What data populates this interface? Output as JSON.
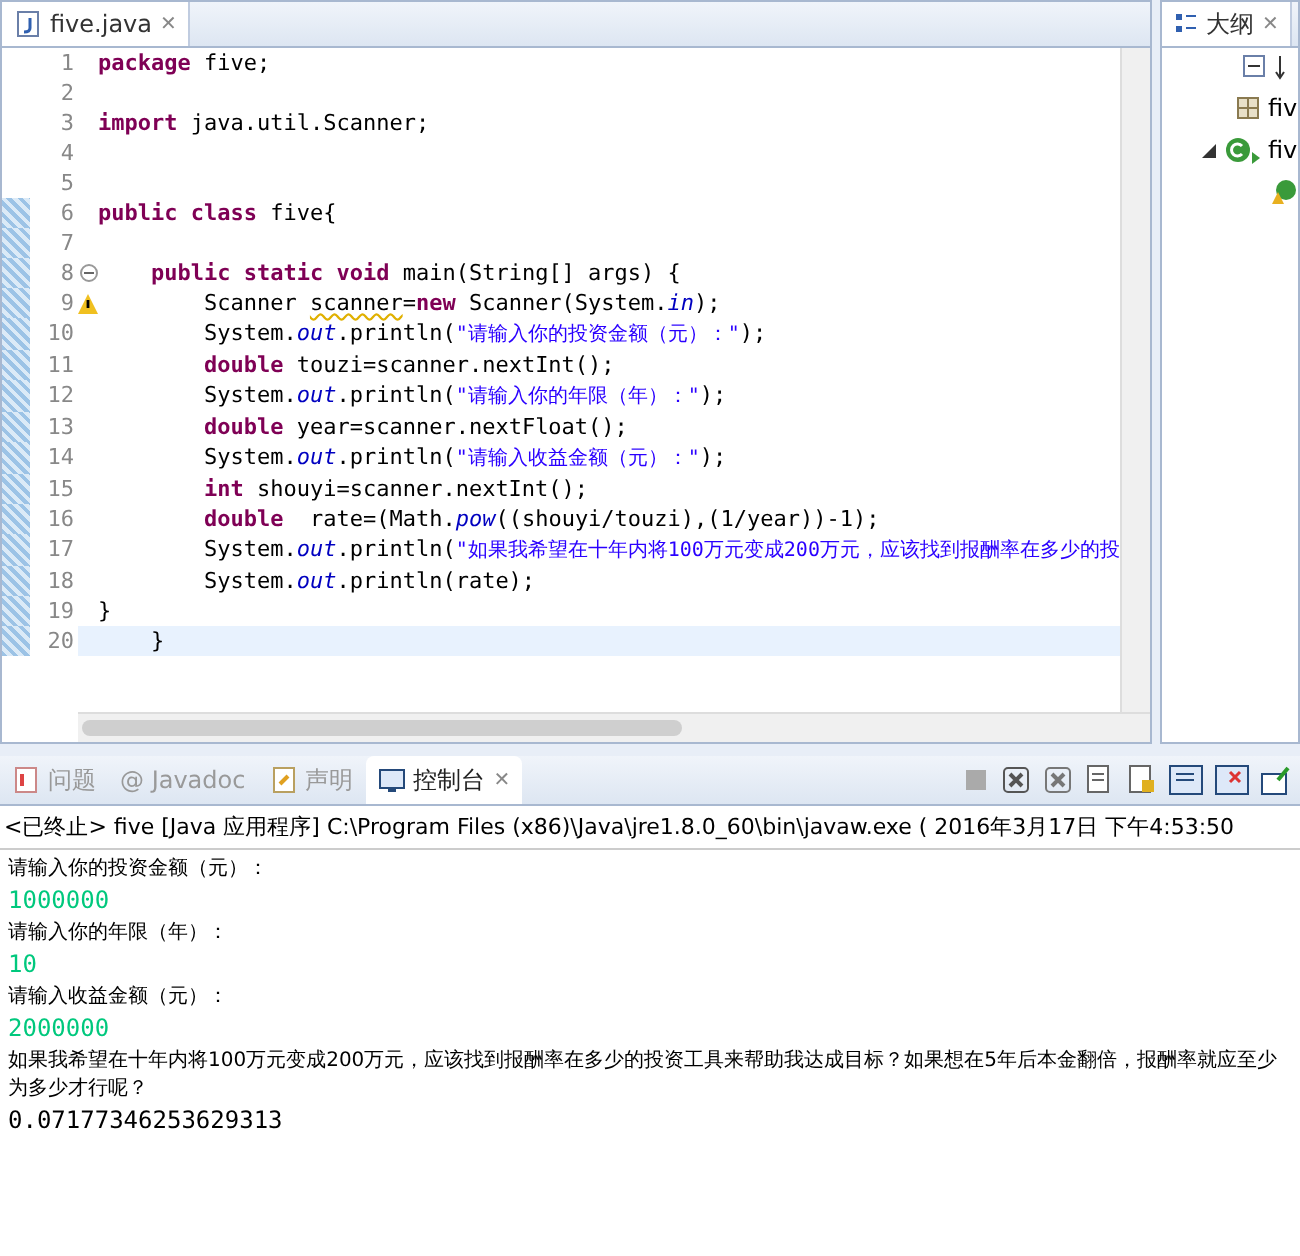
{
  "editor": {
    "tabs": [
      {
        "label": "five.java",
        "close": "✕",
        "selected": true
      }
    ],
    "lines": [
      {
        "num": "1",
        "changed": false,
        "current": false,
        "foldable": false,
        "warning": false,
        "tokens": [
          {
            "kind": "kw",
            "text": "package"
          },
          {
            "kind": "id",
            "text": " five;"
          }
        ]
      },
      {
        "num": "2",
        "changed": false,
        "current": false,
        "foldable": false,
        "warning": false
      },
      {
        "num": "3",
        "changed": false,
        "current": false,
        "foldable": false,
        "warning": false,
        "tokens": [
          {
            "kind": "kw",
            "text": "import"
          },
          {
            "kind": "id",
            "text": " java.util.Scanner;"
          }
        ]
      },
      {
        "num": "4",
        "changed": false,
        "current": false,
        "foldable": false,
        "warning": false
      },
      {
        "num": "5",
        "changed": false,
        "current": false,
        "foldable": false,
        "warning": false
      },
      {
        "num": "6",
        "changed": true,
        "current": false,
        "foldable": false,
        "warning": false,
        "tokens": [
          {
            "kind": "kw",
            "text": "public class"
          },
          {
            "kind": "id",
            "text": " five{"
          }
        ]
      },
      {
        "num": "7",
        "changed": true,
        "current": false,
        "foldable": false,
        "warning": false
      },
      {
        "num": "8",
        "changed": true,
        "current": false,
        "foldable": true,
        "warning": false,
        "tokens": [
          {
            "kind": "kw",
            "text": "    public static void"
          },
          {
            "kind": "id",
            "text": " main(String[] args) {"
          }
        ]
      },
      {
        "num": "9",
        "changed": true,
        "current": false,
        "foldable": false,
        "warning": true,
        "tokens": [
          {
            "kind": "id",
            "text": "        Scanner "
          },
          {
            "kind": "warn",
            "text": "scanner"
          },
          {
            "kind": "id",
            "text": "="
          },
          {
            "kind": "kw",
            "text": "new"
          },
          {
            "kind": "id",
            "text": " Scanner(System."
          },
          {
            "kind": "field",
            "text": "in"
          },
          {
            "kind": "id",
            "text": ");"
          }
        ]
      },
      {
        "num": "10",
        "changed": true,
        "current": false,
        "foldable": false,
        "warning": false,
        "tokens": [
          {
            "kind": "id",
            "text": "        System."
          },
          {
            "kind": "field",
            "text": "out"
          },
          {
            "kind": "id",
            "text": ".println("
          },
          {
            "kind": "str",
            "text": "\"请输入你的投资金额（元）：\""
          },
          {
            "kind": "id",
            "text": ");"
          }
        ]
      },
      {
        "num": "11",
        "changed": true,
        "current": false,
        "foldable": false,
        "warning": false,
        "tokens": [
          {
            "kind": "kw",
            "text": "        double"
          },
          {
            "kind": "id",
            "text": " touzi=scanner.nextInt();"
          }
        ]
      },
      {
        "num": "12",
        "changed": true,
        "current": false,
        "foldable": false,
        "warning": false,
        "tokens": [
          {
            "kind": "id",
            "text": "        System."
          },
          {
            "kind": "field",
            "text": "out"
          },
          {
            "kind": "id",
            "text": ".println("
          },
          {
            "kind": "str",
            "text": "\"请输入你的年限（年）：\""
          },
          {
            "kind": "id",
            "text": ");"
          }
        ]
      },
      {
        "num": "13",
        "changed": true,
        "current": false,
        "foldable": false,
        "warning": false,
        "tokens": [
          {
            "kind": "kw",
            "text": "        double"
          },
          {
            "kind": "id",
            "text": " year=scanner.nextFloat();"
          }
        ]
      },
      {
        "num": "14",
        "changed": true,
        "current": false,
        "foldable": false,
        "warning": false,
        "tokens": [
          {
            "kind": "id",
            "text": "        System."
          },
          {
            "kind": "field",
            "text": "out"
          },
          {
            "kind": "id",
            "text": ".println("
          },
          {
            "kind": "str",
            "text": "\"请输入收益金额（元）：\""
          },
          {
            "kind": "id",
            "text": ");"
          }
        ]
      },
      {
        "num": "15",
        "changed": true,
        "current": false,
        "foldable": false,
        "warning": false,
        "tokens": [
          {
            "kind": "kw",
            "text": "        int"
          },
          {
            "kind": "id",
            "text": " shouyi=scanner.nextInt();"
          }
        ]
      },
      {
        "num": "16",
        "changed": true,
        "current": false,
        "foldable": false,
        "warning": false,
        "tokens": [
          {
            "kind": "kw",
            "text": "        double"
          },
          {
            "kind": "id",
            "text": "  rate=(Math."
          },
          {
            "kind": "field",
            "text": "pow"
          },
          {
            "kind": "id",
            "text": "((shouyi/touzi),(1/year))-1);"
          }
        ]
      },
      {
        "num": "17",
        "changed": true,
        "current": false,
        "foldable": false,
        "warning": false,
        "tokens": [
          {
            "kind": "id",
            "text": "        System."
          },
          {
            "kind": "field",
            "text": "out"
          },
          {
            "kind": "id",
            "text": ".println("
          },
          {
            "kind": "str",
            "text": "\"如果我希望在十年内将100万元变成200万元，应该找到报酬率在多少的投"
          }
        ]
      },
      {
        "num": "18",
        "changed": true,
        "current": false,
        "foldable": false,
        "warning": false,
        "tokens": [
          {
            "kind": "id",
            "text": "        System."
          },
          {
            "kind": "field",
            "text": "out"
          },
          {
            "kind": "id",
            "text": ".println(rate);"
          }
        ]
      },
      {
        "num": "19",
        "changed": true,
        "current": false,
        "foldable": false,
        "warning": false,
        "tokens": [
          {
            "kind": "id",
            "text": "}"
          }
        ]
      },
      {
        "num": "20",
        "changed": true,
        "current": true,
        "foldable": false,
        "warning": false,
        "tokens": [
          {
            "kind": "id",
            "text": "    }"
          }
        ]
      }
    ]
  },
  "outline": {
    "tabs": [
      {
        "label": "大纲",
        "close": "✕",
        "selected": true
      }
    ],
    "items": [
      {
        "kind": "import",
        "label": "fiv"
      },
      {
        "kind": "class",
        "label": "fiv",
        "expanded": true
      },
      {
        "kind": "method"
      }
    ]
  },
  "console": {
    "tabs": [
      {
        "kind": "problems",
        "label": "问题",
        "selected": false
      },
      {
        "kind": "javadoc",
        "label": "@ Javadoc",
        "selected": false
      },
      {
        "kind": "declaration",
        "label": "声明",
        "selected": false
      },
      {
        "kind": "console",
        "label": "控制台",
        "close": "✕",
        "selected": true
      }
    ],
    "header": "<已终止> five [Java 应用程序] C:\\Program Files (x86)\\Java\\jre1.8.0_60\\bin\\javaw.exe ( 2016年3月17日 下午4:53:50",
    "output": [
      {
        "kind": "out",
        "text": "请输入你的投资金额（元）："
      },
      {
        "kind": "in",
        "text": "1000000"
      },
      {
        "kind": "out",
        "text": "请输入你的年限（年）："
      },
      {
        "kind": "in",
        "text": "10"
      },
      {
        "kind": "out",
        "text": "请输入收益金额（元）："
      },
      {
        "kind": "in",
        "text": "2000000"
      },
      {
        "kind": "out",
        "text": "如果我希望在十年内将100万元变成200万元，应该找到报酬率在多少的投资工具来帮助我达成目标？如果想在5年后本金翻倍，报酬率就应至少为多少才行呢？"
      },
      {
        "kind": "result",
        "text": "0.07177346253629313"
      }
    ]
  }
}
